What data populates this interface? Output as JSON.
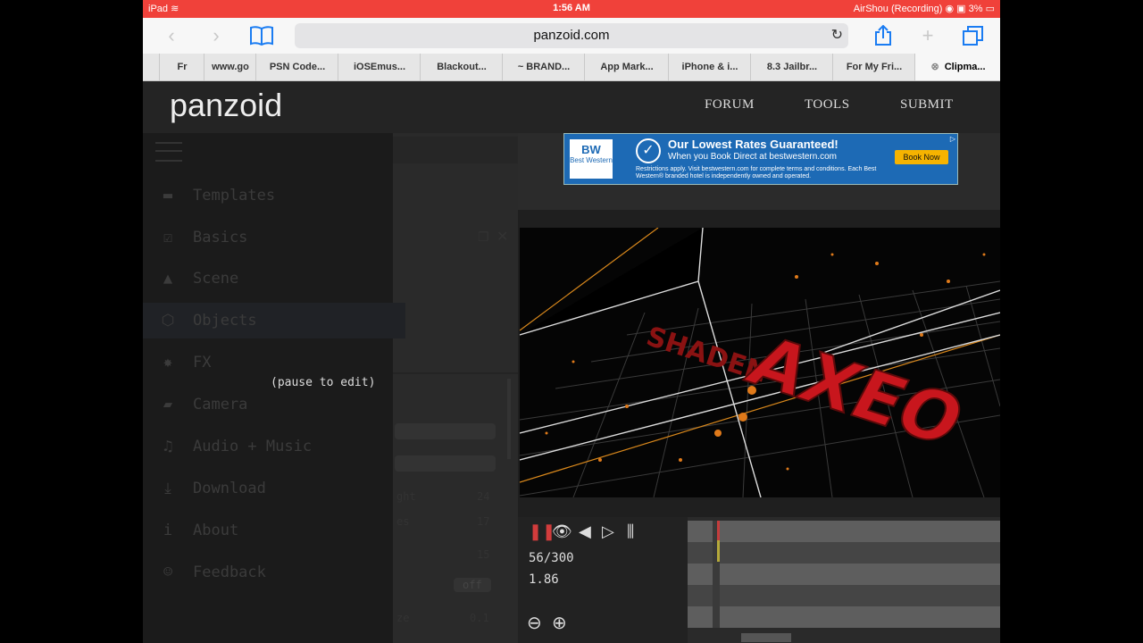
{
  "status_bar": {
    "device": "iPad",
    "wifi_icon": "wifi-icon",
    "time": "1:56 AM",
    "recording": "AirShou (Recording)",
    "battery": "3%"
  },
  "browser": {
    "url": "panzoid.com",
    "tabs": [
      {
        "label": "Fr"
      },
      {
        "label": "www.go"
      },
      {
        "label": "PSN Code..."
      },
      {
        "label": "iOSEmus..."
      },
      {
        "label": "Blackout..."
      },
      {
        "label": "~ BRAND..."
      },
      {
        "label": "App Mark..."
      },
      {
        "label": "iPhone & i..."
      },
      {
        "label": "8.3 Jailbr..."
      },
      {
        "label": "For My Fri..."
      },
      {
        "label": "Clipma..."
      }
    ]
  },
  "site": {
    "logo": "panzoid",
    "nav": {
      "forum": "FORUM",
      "tools": "TOOLS",
      "submit": "SUBMIT"
    }
  },
  "sidebar": {
    "items": [
      {
        "label": "Templates",
        "icon": "folder-icon"
      },
      {
        "label": "Basics",
        "icon": "checkbox-icon"
      },
      {
        "label": "Scene",
        "icon": "landscape-icon"
      },
      {
        "label": "Objects",
        "icon": "cube-icon"
      },
      {
        "label": "FX",
        "icon": "burst-icon"
      },
      {
        "label": "Camera",
        "icon": "camera-icon"
      },
      {
        "label": "Audio + Music",
        "icon": "music-icon"
      },
      {
        "label": "Download",
        "icon": "download-icon"
      },
      {
        "label": "About",
        "icon": "info-icon"
      },
      {
        "label": "Feedback",
        "icon": "smile-icon"
      }
    ],
    "pause_hint": "(pause to edit)",
    "ghost_values": {
      "v1": "24",
      "v2": "17",
      "v3": "15",
      "v4": "0.1",
      "off": "off",
      "row1": "ght",
      "row2": "es",
      "row3": "ze"
    }
  },
  "ad": {
    "brand": "Best Western",
    "headline": "Our Lowest Rates Guaranteed!",
    "subline": "When you Book Direct at bestwestern.com",
    "fineprint": "Restrictions apply. Visit bestwestern.com for complete terms and conditions. Each Best Western® branded hotel is independently owned and operated.",
    "cta": "Book Now",
    "bw": "BW"
  },
  "viewport": {
    "text_front": "AXEO",
    "text_back": "SHADEN"
  },
  "timeline": {
    "frame": "56/300",
    "time": "1.86",
    "progress": 0.1867
  },
  "colors": {
    "status_bar": "#f0413a",
    "accent_blue": "#1a7cf2",
    "text_red": "#c8161d",
    "grid_orange": "#d9881c"
  }
}
